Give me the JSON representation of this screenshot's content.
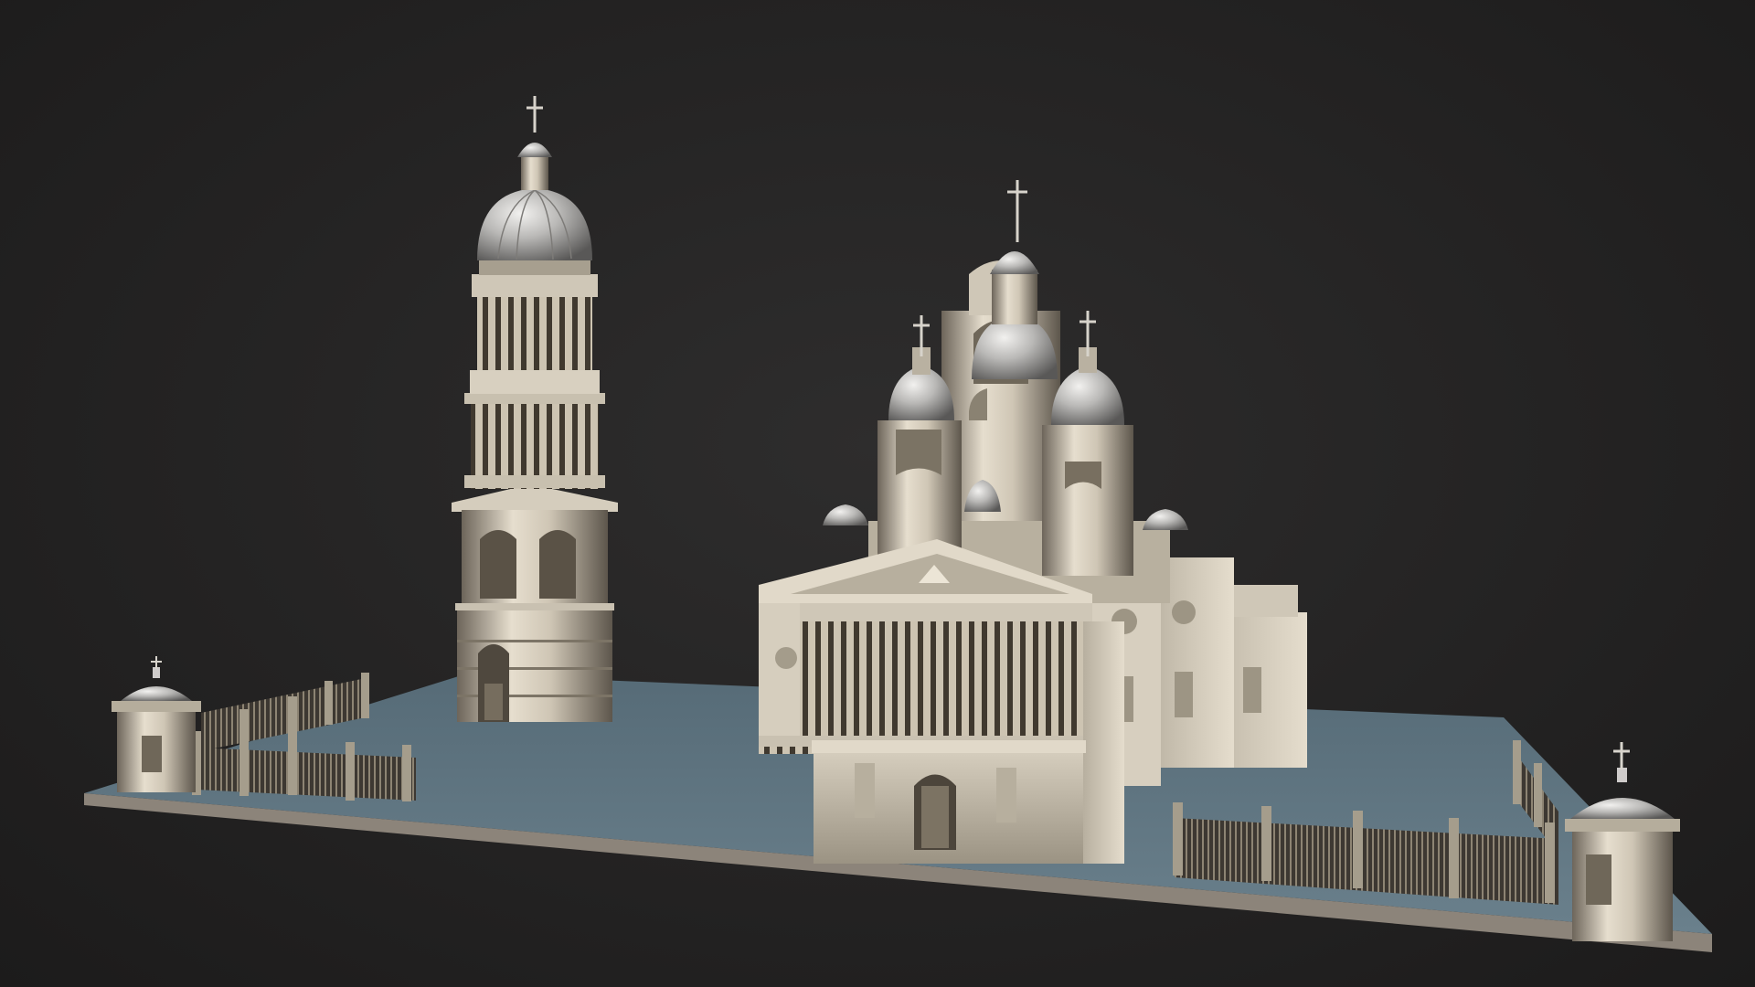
{
  "scene": {
    "subject": "",
    "colors": {
      "background": "#262525",
      "base_top": "#5f7581",
      "base_edge": "#8a8178",
      "stone_light": "#e4dccd",
      "stone_mid": "#a39b8c",
      "stone_dark": "#4d463e",
      "dome_metal": "#c9c8c6"
    }
  }
}
